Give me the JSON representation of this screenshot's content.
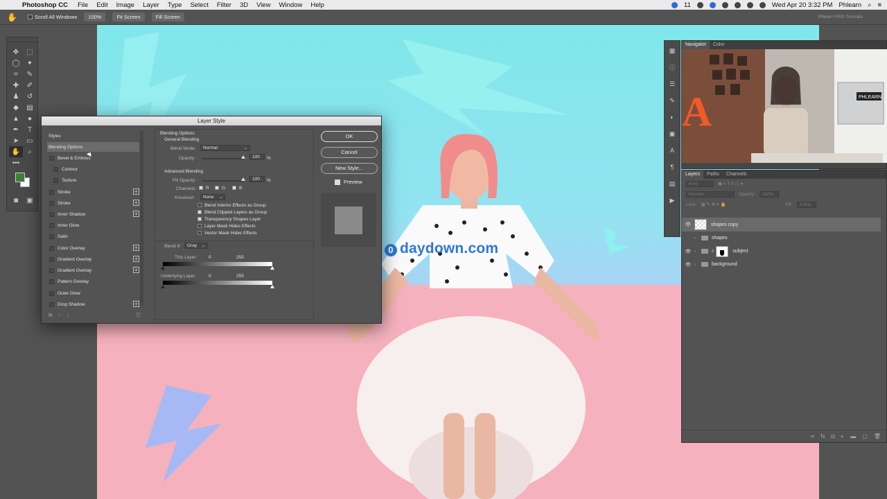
{
  "menubar": {
    "app_name": "Photoshop CC",
    "items": [
      "File",
      "Edit",
      "Image",
      "Layer",
      "Type",
      "Select",
      "Filter",
      "3D",
      "View",
      "Window",
      "Help"
    ],
    "badge": "11",
    "clock": "Wed Apr 20  3:32 PM",
    "user": "Phlearn"
  },
  "optionsbar": {
    "scroll_all_windows": "Scroll All Windows",
    "zoom_100": "100%",
    "fit_screen": "Fit Screen",
    "fill_screen": "Fill Screen",
    "tag": "Phlearn PRO Tutorials"
  },
  "canvas": {
    "watermark": "daydown.com",
    "watermark_glyph": "0"
  },
  "navigator": {
    "tabs": [
      "Navigator",
      "Color"
    ],
    "video_logo": "PHLEARN"
  },
  "layers": {
    "tabs": [
      "Layers",
      "Paths",
      "Channels"
    ],
    "kind_label": "Kind",
    "blend_mode": "Normal",
    "opacity_label": "Opacity:",
    "opacity_value": "100%",
    "lock_label": "Lock:",
    "fill_label": "Fill:",
    "fill_value": "100%",
    "rows": [
      {
        "name": "shapes copy"
      },
      {
        "name": "shapes"
      },
      {
        "name": "subject"
      },
      {
        "name": "background"
      }
    ]
  },
  "dialog": {
    "title": "Layer Style",
    "styles_header": "Styles",
    "styles": [
      {
        "label": "Blending Options",
        "selected": true
      },
      {
        "label": "Bevel & Emboss",
        "checkbox": true
      },
      {
        "label": "Contour",
        "checkbox": true,
        "indent": true
      },
      {
        "label": "Texture",
        "checkbox": true,
        "indent": true
      },
      {
        "label": "Stroke",
        "checkbox": true,
        "plus": true
      },
      {
        "label": "Stroke",
        "checkbox": true,
        "plus": true
      },
      {
        "label": "Inner Shadow",
        "checkbox": true,
        "plus": true
      },
      {
        "label": "Inner Glow",
        "checkbox": true
      },
      {
        "label": "Satin",
        "checkbox": true
      },
      {
        "label": "Color Overlay",
        "checkbox": true,
        "plus": true
      },
      {
        "label": "Gradient Overlay",
        "checkbox": true,
        "plus": true
      },
      {
        "label": "Gradient Overlay",
        "checkbox": true,
        "plus": true
      },
      {
        "label": "Pattern Overlay",
        "checkbox": true
      },
      {
        "label": "Outer Glow",
        "checkbox": true
      },
      {
        "label": "Drop Shadow",
        "checkbox": true,
        "plus": true
      }
    ],
    "fx_label": "fx",
    "blending_options": "Blending Options",
    "general_blending": "General Blending",
    "blend_mode_label": "Blend Mode:",
    "blend_mode_value": "Normal",
    "opacity_label": "Opacity:",
    "opacity_value": "100",
    "percent": "%",
    "advanced_blending": "Advanced Blending",
    "fill_opacity_label": "Fill Opacity:",
    "fill_opacity_value": "100",
    "channels_label": "Channels:",
    "channel_r": "R",
    "channel_g": "G",
    "channel_b": "B",
    "knockout_label": "Knockout:",
    "knockout_value": "None",
    "advanced_checks": [
      {
        "label": "Blend Interior Effects as Group",
        "checked": false
      },
      {
        "label": "Blend Clipped Layers as Group",
        "checked": true
      },
      {
        "label": "Transparency Shapes Layer",
        "checked": true
      },
      {
        "label": "Layer Mask Hides Effects",
        "checked": false
      },
      {
        "label": "Vector Mask Hides Effects",
        "checked": false
      }
    ],
    "blend_if_label": "Blend If:",
    "blend_if_value": "Gray",
    "this_layer_label": "This Layer:",
    "this_layer_min": "0",
    "this_layer_max": "255",
    "underlying_label": "Underlying Layer:",
    "underlying_min": "0",
    "underlying_max": "255",
    "ok": "OK",
    "cancel": "Cancel",
    "new_style": "New Style...",
    "preview": "Preview"
  }
}
